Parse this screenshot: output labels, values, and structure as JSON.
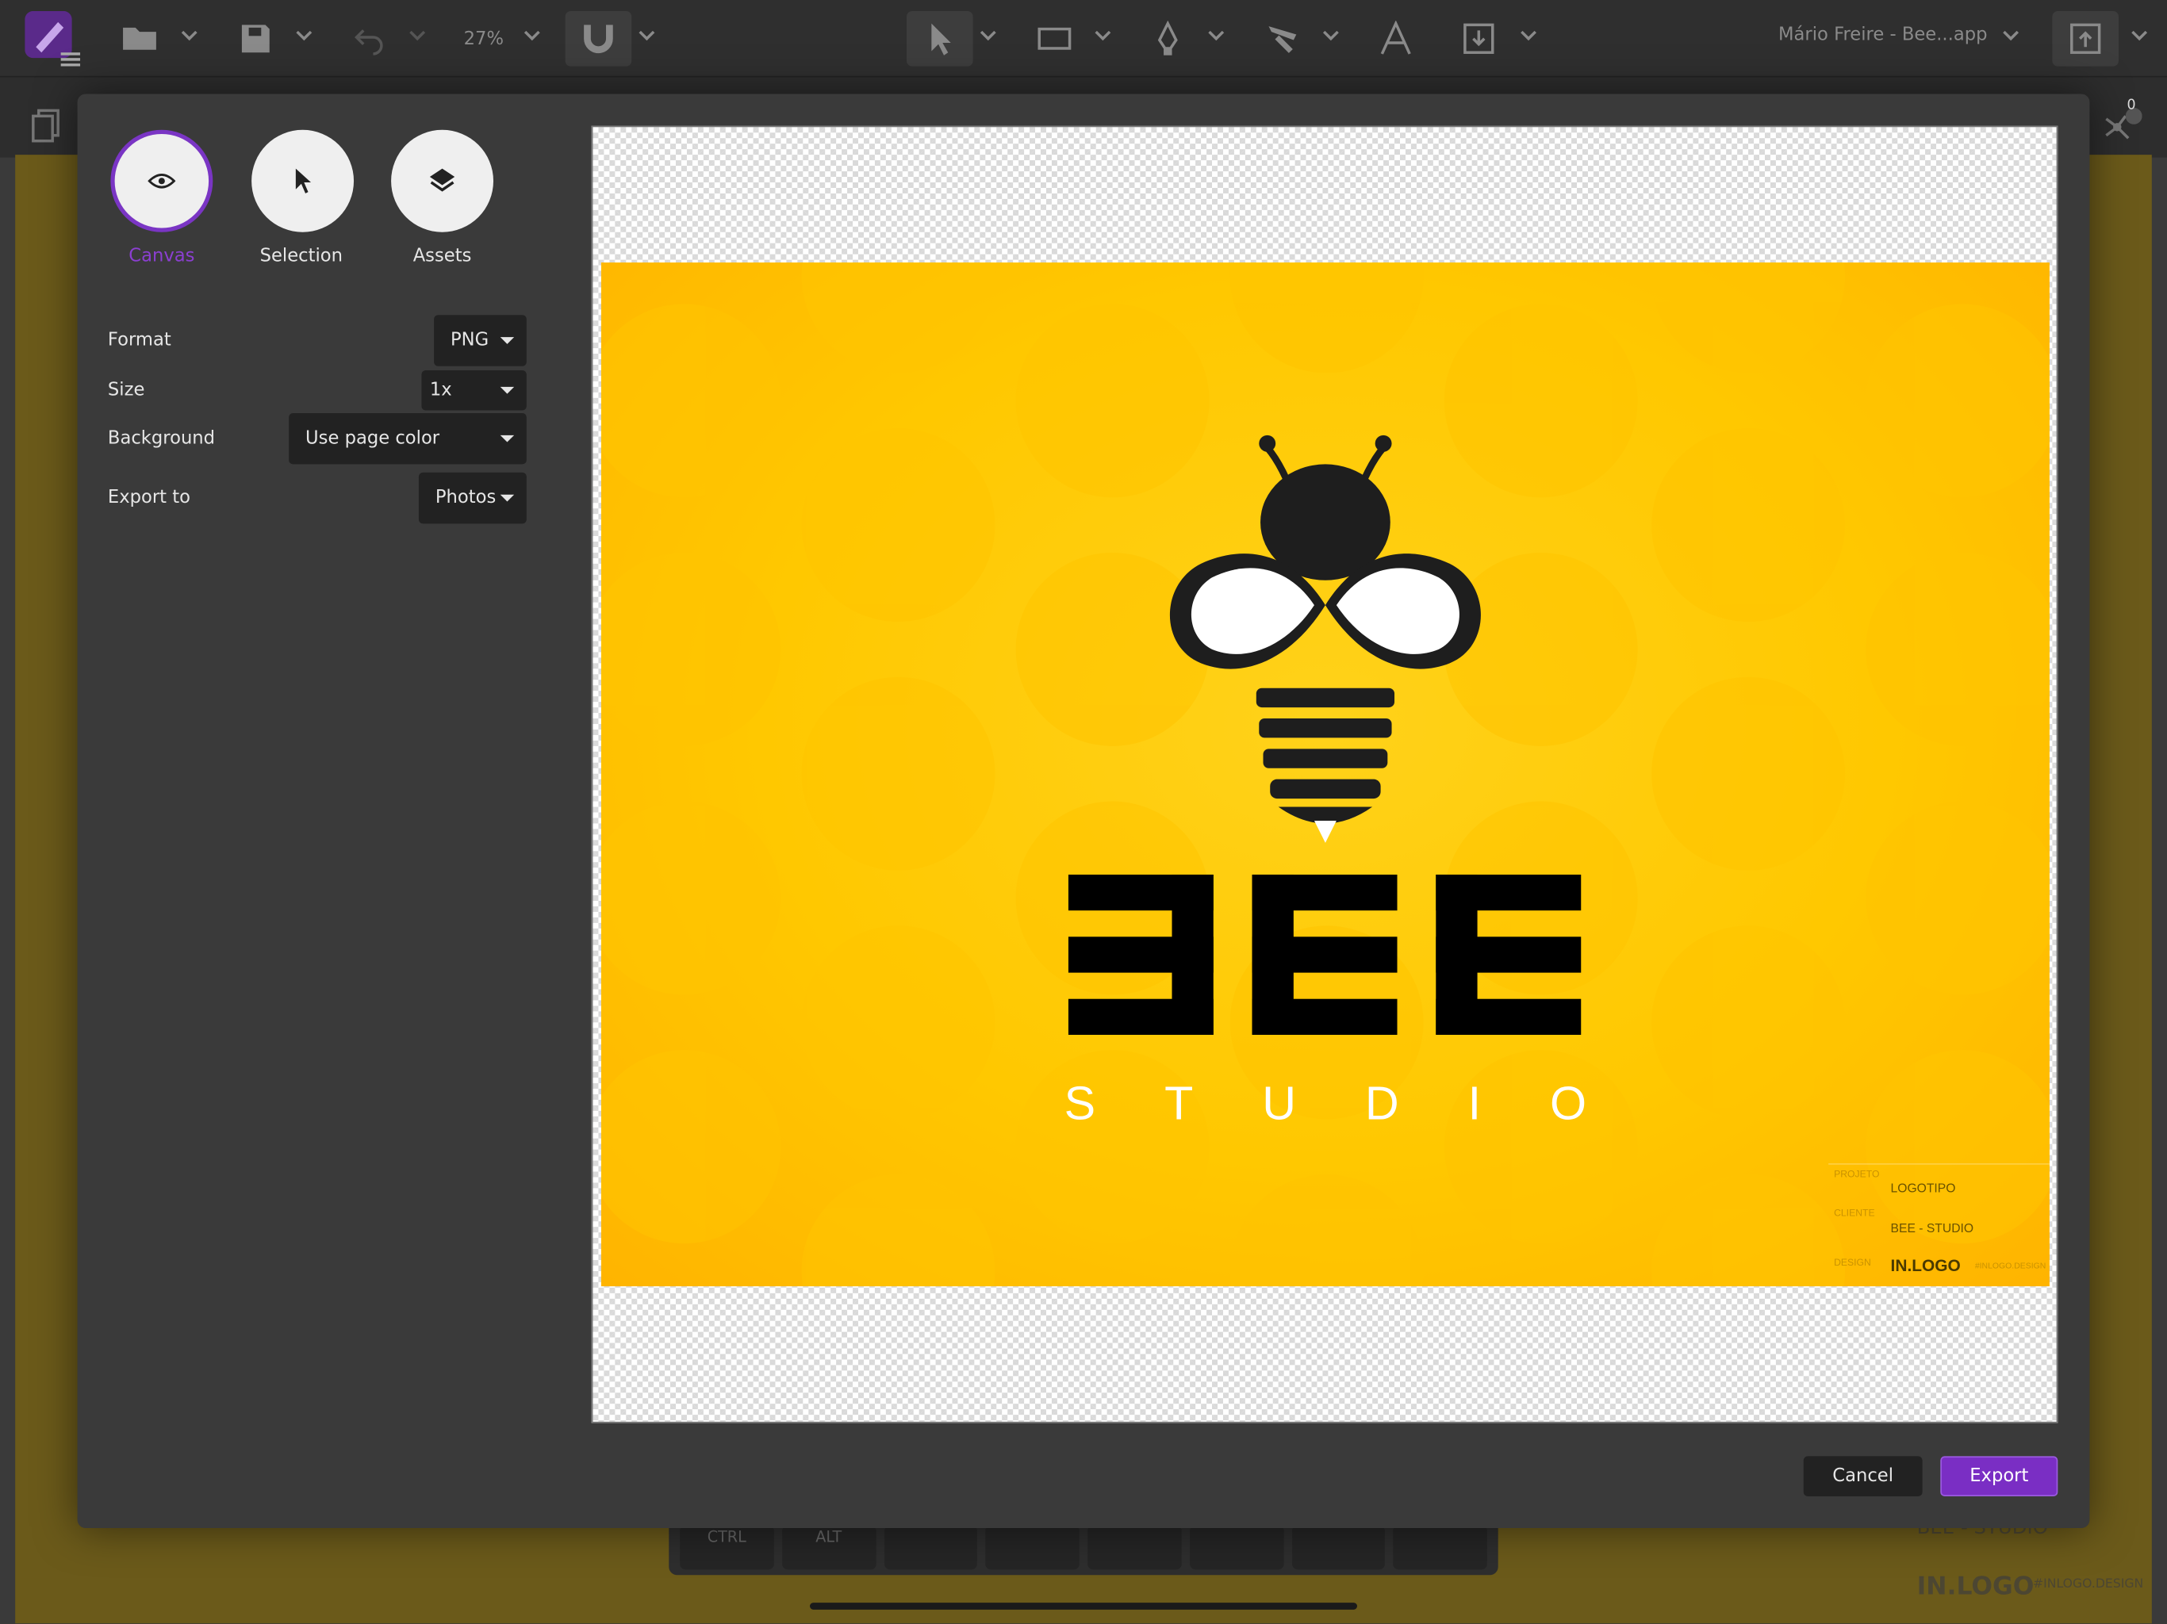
{
  "toolbar": {
    "zoom": "27%",
    "document_title": "Mário Freire - Bee...app",
    "icons": [
      "app-logo-icon",
      "folder-open-icon",
      "save-icon",
      "undo-icon",
      "magnet-icon",
      "pointer-icon",
      "rectangle-icon",
      "pen-icon",
      "brush-icon",
      "text-icon",
      "import-icon",
      "share-icon"
    ]
  },
  "background": {
    "keys": [
      "CTRL",
      "ALT",
      "",
      "",
      "",
      "",
      "",
      ""
    ],
    "tag_client": "BEE - STUDIO",
    "tag_brand": "IN.LOGO",
    "tag_brand_small": "#INLOGO.DESIGN",
    "notifications_count": "0"
  },
  "dialog": {
    "modes": [
      {
        "label": "Canvas",
        "icon": "eye-icon",
        "selected": true
      },
      {
        "label": "Selection",
        "icon": "cursor-icon",
        "selected": false
      },
      {
        "label": "Assets",
        "icon": "layers-icon",
        "selected": false
      }
    ],
    "fields": {
      "format": {
        "label": "Format",
        "value": "PNG"
      },
      "size": {
        "label": "Size",
        "value": "1x"
      },
      "background": {
        "label": "Background",
        "value": "Use page color"
      },
      "export_to": {
        "label": "Export to",
        "value": "Photos"
      }
    },
    "preview": {
      "studio_letters": [
        "S",
        "T",
        "U",
        "D",
        "I",
        "O"
      ],
      "tag_project_label": "PROJETO",
      "tag_project": "LOGOTIPO",
      "tag_client_label": "CLIENTE",
      "tag_client": "BEE - STUDIO",
      "tag_design_label": "DESIGN",
      "tag_brand": "IN.LOGO",
      "tag_brand_small": "#INLOGO.DESIGN"
    },
    "buttons": {
      "cancel": "Cancel",
      "export": "Export"
    },
    "accent": "#7a2ec4"
  }
}
